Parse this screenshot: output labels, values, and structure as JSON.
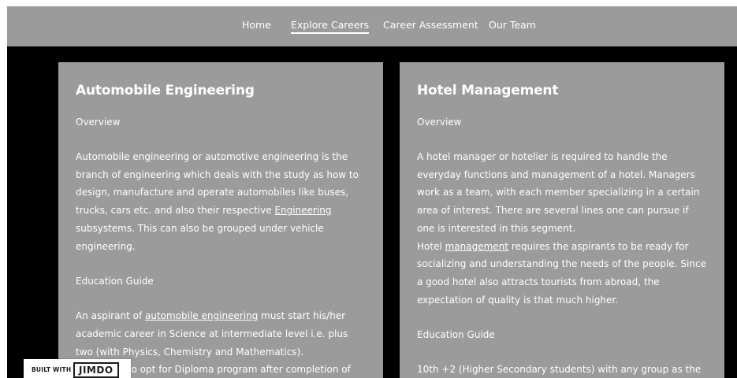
{
  "nav": {
    "items": [
      "Home",
      "Explore Careers",
      "Career Assessment",
      "Our Team"
    ],
    "active": "Explore Careers"
  },
  "cards": [
    {
      "title": "Automobile Engineering",
      "overview_label": "Overview",
      "overview_text_1": "Automobile engineering or automotive engineering is the branch of engineering which deals with the study as how to design, manufacture and operate automobiles like buses, trucks, cars etc. and also their respective ",
      "overview_link": "Engineering",
      "overview_text_2": " subsystems. This can also be grouped under vehicle engineering.",
      "education_label": "Education Guide",
      "education_text_1": "An aspirant of ",
      "education_link": "automobile engineering",
      "education_text_2": " must start his/her academic career in Science at intermediate level i.e. plus two (with Physics, Chemistry and Mathematics).",
      "education_text_3": "One can also opt for Diploma program after completion of"
    },
    {
      "title": "Hotel Management",
      "overview_label": "Overview",
      "overview_text_1": "A hotel manager or hotelier is required to handle the everyday functions and management of a hotel. Managers work as a team, with each member specializing in a certain area of interest. There are several lines one can pursue if one is interested in this segment.",
      "overview_text_2a": "Hotel ",
      "overview_link": "management",
      "overview_text_2b": " requires the aspirants to be ready for socializing and understanding the needs of the people. Since a good hotel also attracts tourists from abroad, the expectation of quality is that much higher.",
      "education_label": "Education Guide",
      "education_text_1": "10th +2 (Higher Secondary students) with any group as the"
    }
  ],
  "badge": {
    "built_with": "BUILT WITH",
    "logo": "JIMDO"
  },
  "colors": {
    "nav_bg": "#9b9b9b",
    "stage_bg": "#000000",
    "card_bg": "#9b9b9b",
    "text": "#ffffff"
  }
}
